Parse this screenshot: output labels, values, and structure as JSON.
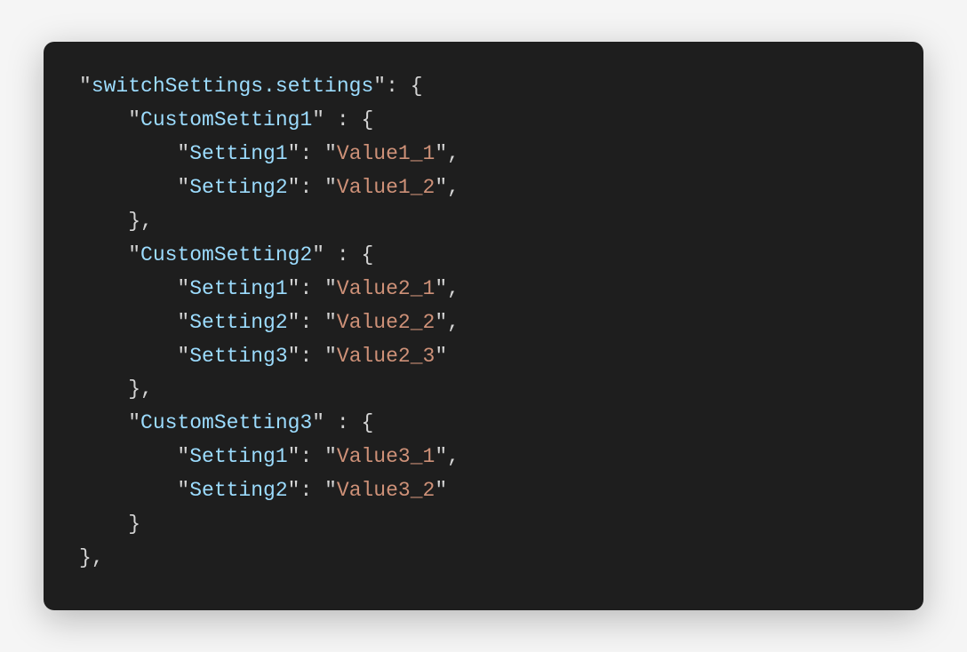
{
  "code": {
    "rootKey": "switchSettings.settings",
    "groups": [
      {
        "name": "CustomSetting1",
        "entries": [
          {
            "key": "Setting1",
            "value": "Value1_1",
            "trailingComma": true
          },
          {
            "key": "Setting2",
            "value": "Value1_2",
            "trailingComma": true
          }
        ],
        "trailingComma": true
      },
      {
        "name": "CustomSetting2",
        "entries": [
          {
            "key": "Setting1",
            "value": "Value2_1",
            "trailingComma": true
          },
          {
            "key": "Setting2",
            "value": "Value2_2",
            "trailingComma": true
          },
          {
            "key": "Setting3",
            "value": "Value2_3",
            "trailingComma": false
          }
        ],
        "trailingComma": true
      },
      {
        "name": "CustomSetting3",
        "entries": [
          {
            "key": "Setting1",
            "value": "Value3_1",
            "trailingComma": true
          },
          {
            "key": "Setting2",
            "value": "Value3_2",
            "trailingComma": false
          }
        ],
        "trailingComma": false
      }
    ]
  },
  "colors": {
    "background": "#1e1e1e",
    "key": "#9cdcfe",
    "string": "#ce9178",
    "punctuation": "#d4d4d4"
  }
}
